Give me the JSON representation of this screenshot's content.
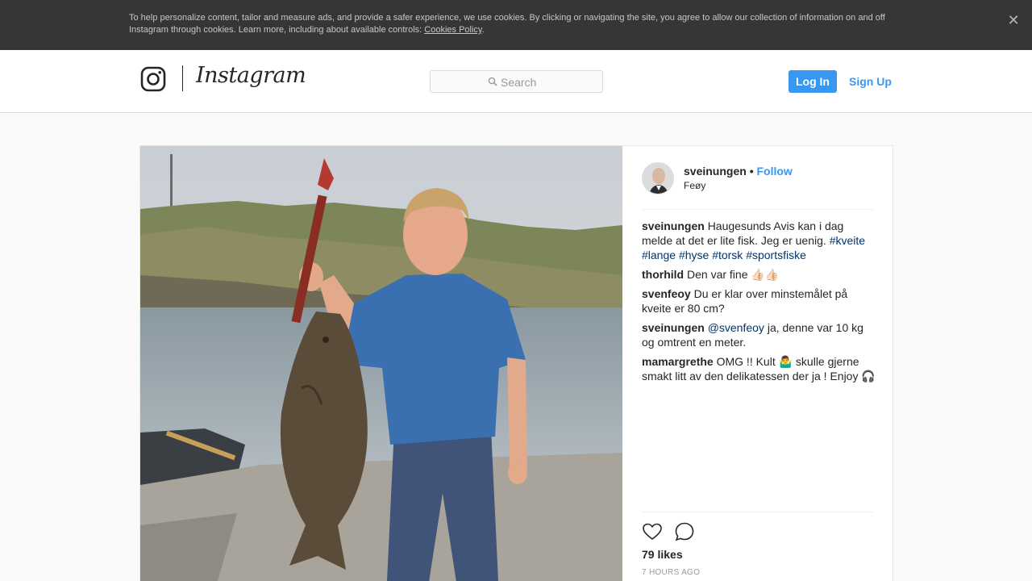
{
  "cookie_banner": {
    "text": "To help personalize content, tailor and measure ads, and provide a safer experience, we use cookies. By clicking or navigating the site, you agree to allow our collection of information on and off Instagram through cookies. Learn more, including about available controls: ",
    "link": "Cookies Policy",
    "after_link": ".",
    "close_icon": "close-icon"
  },
  "nav": {
    "brand": "Instagram",
    "search_placeholder": "Search",
    "login": "Log In",
    "signup": "Sign Up"
  },
  "post": {
    "username": "sveinungen",
    "separator": "•",
    "follow": "Follow",
    "location": "Feøy",
    "comments": [
      {
        "user": "sveinungen",
        "parts": [
          {
            "text": "Haugesunds Avis kan i dag melde at det er lite fisk. Jeg er uenig. "
          },
          {
            "text": "#kveite",
            "tag": true
          },
          {
            "text": " "
          },
          {
            "text": "#lange",
            "tag": true
          },
          {
            "text": " "
          },
          {
            "text": "#hyse",
            "tag": true
          },
          {
            "text": " "
          },
          {
            "text": "#torsk",
            "tag": true
          },
          {
            "text": " "
          },
          {
            "text": "#sportsfiske",
            "tag": true
          }
        ]
      },
      {
        "user": "thorhild",
        "parts": [
          {
            "text": "Den var fine 👍🏻👍🏻"
          }
        ]
      },
      {
        "user": "svenfeoy",
        "parts": [
          {
            "text": "Du er klar over minstemålet på kveite er 80 cm?"
          }
        ]
      },
      {
        "user": "sveinungen",
        "parts": [
          {
            "text": "@svenfeoy",
            "tag": true
          },
          {
            "text": " ja, denne var 10 kg og omtrent en meter."
          }
        ]
      },
      {
        "user": "mamargrethe",
        "parts": [
          {
            "text": "OMG !! Kult 🤷‍♂️ skulle gjerne smakt litt av den delikatessen der ja ! Enjoy 🎧"
          }
        ]
      }
    ],
    "likes": "79 likes",
    "time": "7 HOURS AGO"
  },
  "colors": {
    "accent": "#3897f0",
    "hashtag": "#003569",
    "banner_bg": "#363636"
  }
}
